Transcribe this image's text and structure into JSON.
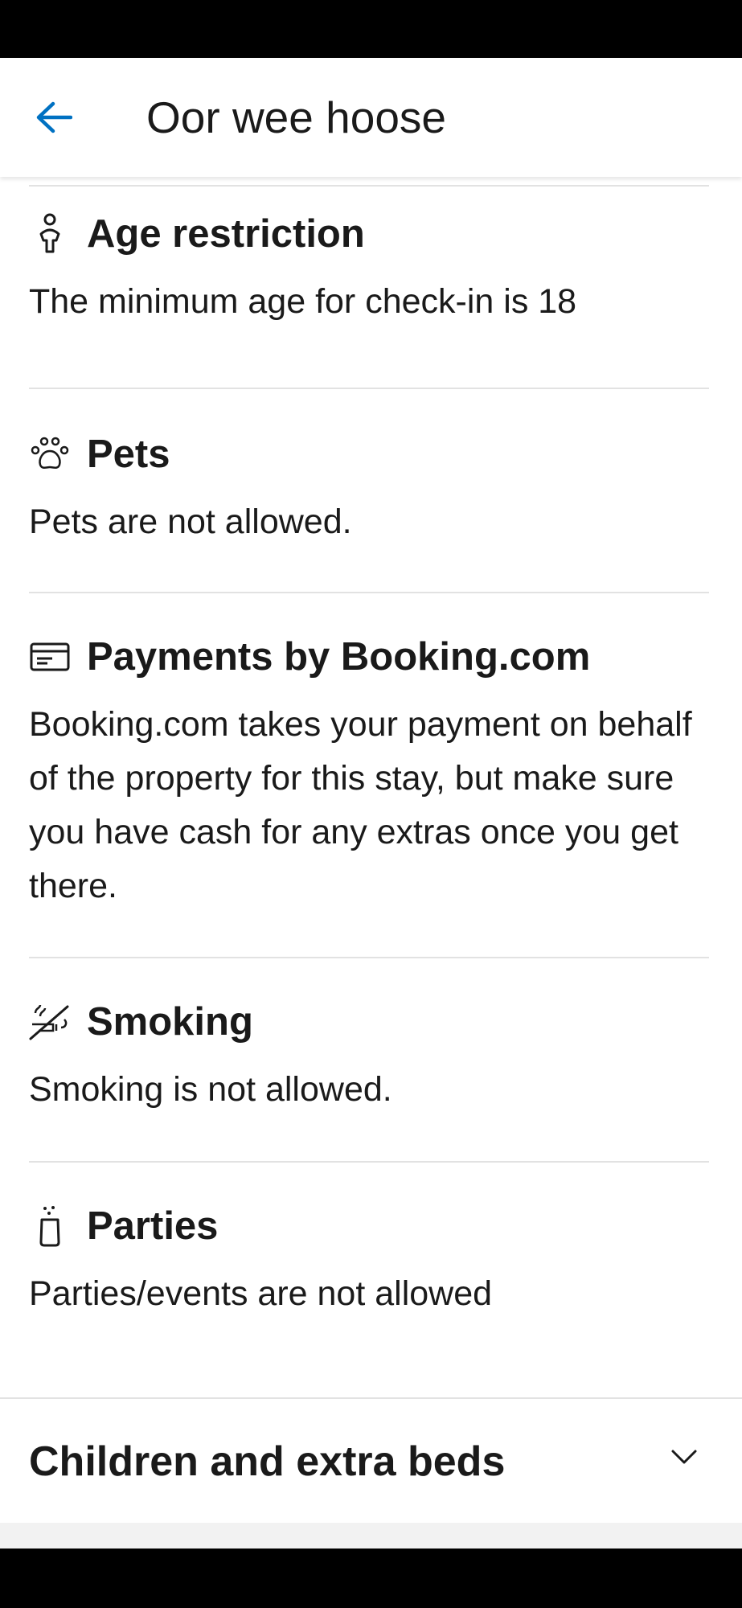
{
  "header": {
    "title": "Oor wee hoose",
    "back_icon": "arrow-left-icon",
    "accent_color": "#0071c2"
  },
  "rules": [
    {
      "id": "age",
      "icon": "person-icon",
      "title": "Age restriction",
      "body": "The minimum age for check-in is 18"
    },
    {
      "id": "pets",
      "icon": "paw-icon",
      "title": "Pets",
      "body": "Pets are not allowed."
    },
    {
      "id": "payments",
      "icon": "credit-card-icon",
      "title": "Payments by Booking.com",
      "body": "Booking.com takes your payment on behalf of the property for this stay, but make sure you have cash for any extras once you get there."
    },
    {
      "id": "smoking",
      "icon": "no-smoking-icon",
      "title": "Smoking",
      "body": "Smoking is not allowed."
    },
    {
      "id": "parties",
      "icon": "party-icon",
      "title": "Parties",
      "body": "Parties/events are not allowed"
    }
  ],
  "children_section": {
    "title": "Children and extra beds",
    "icon": "chevron-down-icon"
  }
}
